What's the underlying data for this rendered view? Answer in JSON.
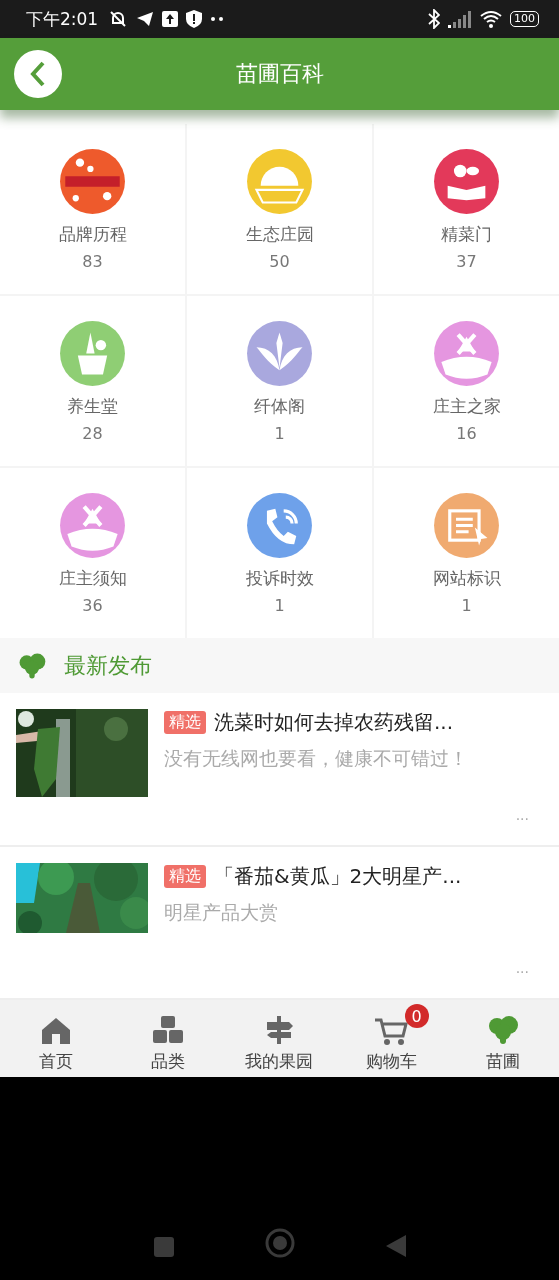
{
  "status_bar": {
    "time": "下午2:01",
    "battery": "100"
  },
  "header": {
    "title": "苗圃百科"
  },
  "categories": [
    {
      "label": "品牌历程",
      "count": "83",
      "color": "#ee5a2c"
    },
    {
      "label": "生态庄园",
      "count": "50",
      "color": "#f2c830"
    },
    {
      "label": "精菜门",
      "count": "37",
      "color": "#e3395a"
    },
    {
      "label": "养生堂",
      "count": "28",
      "color": "#8fce74"
    },
    {
      "label": "纤体阁",
      "count": "1",
      "color": "#a9a8de"
    },
    {
      "label": "庄主之家",
      "count": "16",
      "color": "#e596e0"
    },
    {
      "label": "庄主须知",
      "count": "36",
      "color": "#e596e0"
    },
    {
      "label": "投诉时效",
      "count": "1",
      "color": "#6ea1ea"
    },
    {
      "label": "网站标识",
      "count": "1",
      "color": "#f0aa70"
    }
  ],
  "section": {
    "title": "最新发布"
  },
  "articles": [
    {
      "tag": "精选",
      "title": "洗菜时如何去掉农药残留...",
      "summary": "没有无线网也要看，健康不可错过！",
      "more": "...",
      "kind": "picture"
    },
    {
      "tag": "精选",
      "title": "「番茄&黄瓜」2大明星产...",
      "summary": "明星产品大赏",
      "more": "...",
      "kind": "picture"
    }
  ],
  "tab_bar": [
    {
      "label": "首页",
      "selected": false
    },
    {
      "label": "品类",
      "selected": false
    },
    {
      "label": "我的果园",
      "selected": false
    },
    {
      "label": "购物车",
      "selected": false,
      "badge": "0"
    },
    {
      "label": "苗圃",
      "selected": true
    }
  ]
}
